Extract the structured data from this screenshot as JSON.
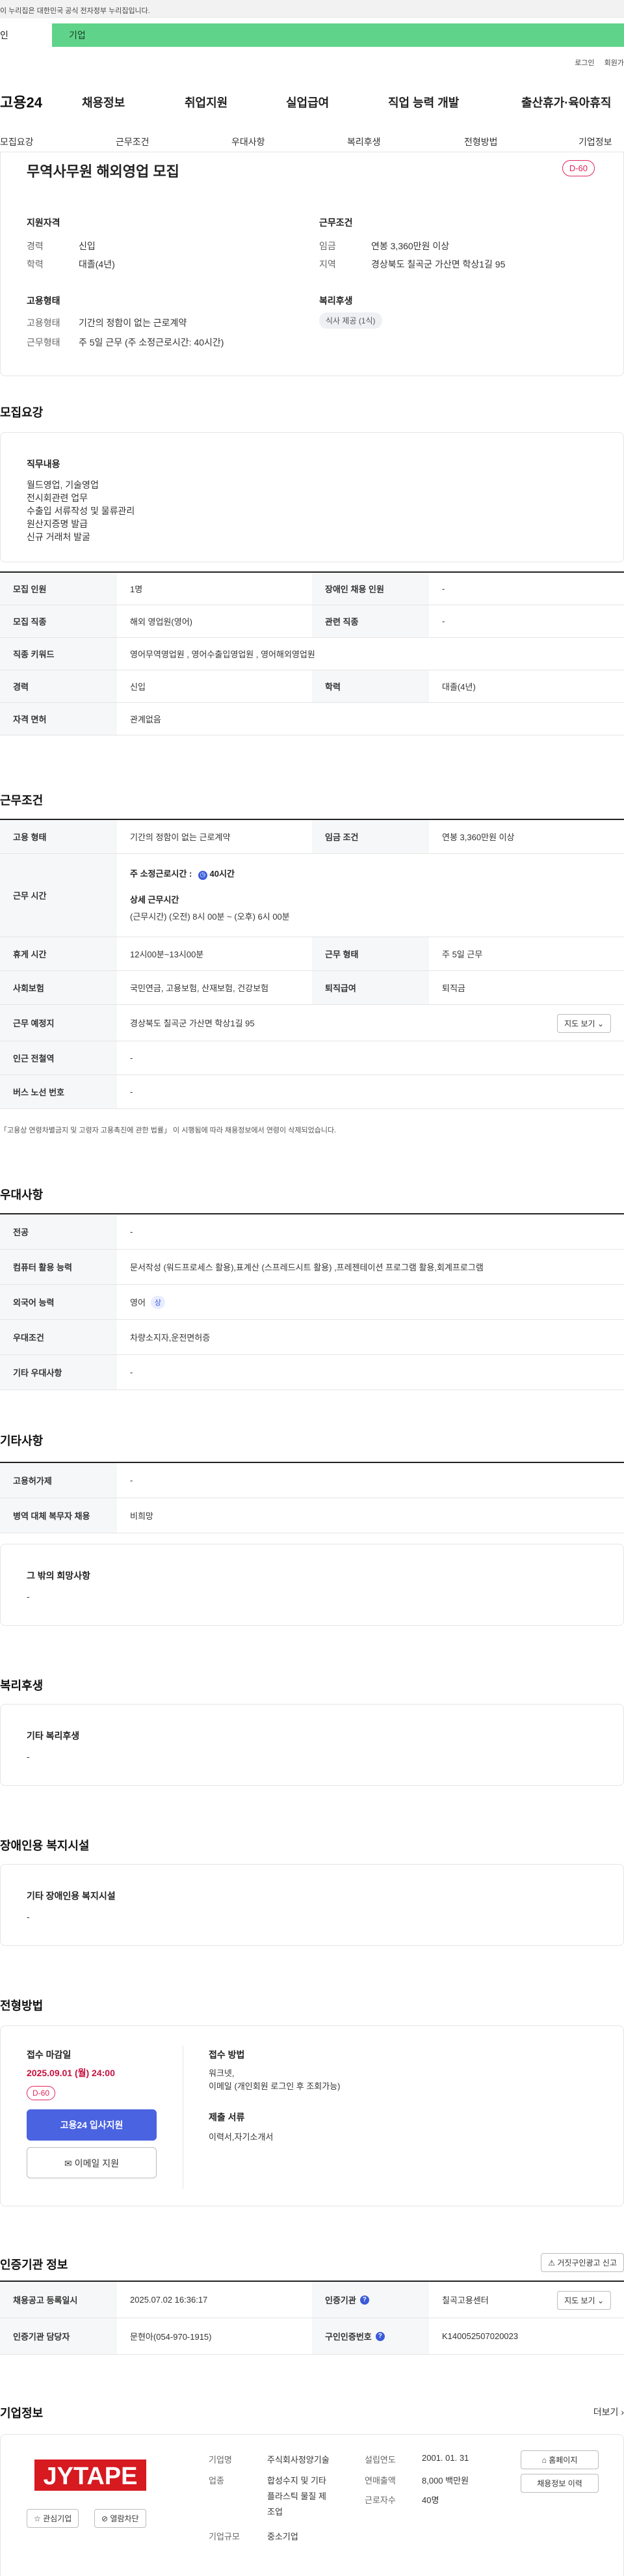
{
  "gov_notice": "이 누리집은 대한민국 공식 전자정부 누리집입니다.",
  "tabs": {
    "person": "인",
    "corp": "기업"
  },
  "util": {
    "login": "로그인",
    "join": "회원가"
  },
  "gnb": {
    "logo": "고용24",
    "menus": [
      "채용정보",
      "취업지원",
      "실업급여",
      "직업 능력 개발",
      "출산휴가·육아휴직"
    ]
  },
  "subnav": [
    "모집요강",
    "근무조건",
    "우대사항",
    "복리후생",
    "전형방법",
    "기업정보"
  ],
  "summary": {
    "title": "무역사무원 해외영업 모집",
    "dday": "D-60",
    "qual_label": "지원자격",
    "career_k": "경력",
    "career_v": "신입",
    "edu_k": "학력",
    "edu_v": "대졸(4년)",
    "cond_label": "근무조건",
    "wage_k": "임금",
    "wage_v": "연봉 3,360만원 이상",
    "region_k": "지역",
    "region_v": "경상북도 칠곡군 가산면 학상1길 95",
    "emp_label": "고용형태",
    "emp_k": "고용형태",
    "emp_v": "기간의 정함이 없는 근로계약",
    "work_k": "근무형태",
    "work_v": "주 5일 근무 (주 소정근로시간: 40시간)",
    "welfare_label": "복리후생",
    "welfare_chip": "식사 제공 (1식)"
  },
  "recruit": {
    "heading": "모집요강",
    "duty_title": "직무내용",
    "duty_lines": [
      "월드영업, 기술영업",
      "전시회관련 업무",
      "수출입 서류작성 및 물류관리",
      "원산지증명 발급",
      "신규 거래처 발굴"
    ],
    "rows": [
      {
        "k1": "모집 인원",
        "v1": "1명",
        "k2": "장애인 채용 인원",
        "v2": "-"
      },
      {
        "k1": "모집 직종",
        "v1": "해외 영업원(영어)",
        "k2": "관련 직종",
        "v2": "-"
      },
      {
        "k1": "직종 키워드",
        "v1": "영어무역영업원 , 영어수출입영업원 , 영어해외영업원"
      },
      {
        "k1": "경력",
        "v1": "신입",
        "k2": "학력",
        "v2": "대졸(4년)"
      },
      {
        "k1": "자격 면허",
        "v1": "관계없음"
      }
    ]
  },
  "workcond": {
    "heading": "근무조건",
    "r1": {
      "k1": "고용 형태",
      "v1": "기간의 정함이 없는 근로계약",
      "k2": "임금 조건",
      "v2": "연봉 3,360만원 이상"
    },
    "r2": {
      "k1": "근무 시간",
      "hours_prefix": "주 소정근로시간 :",
      "hours_val": "40시간",
      "detail_title": "상세 근무시간",
      "detail": "(근무시간) (오전) 8시 00분 ~ (오후) 6시 00분"
    },
    "r3": {
      "k1": "휴게 시간",
      "v1": "12시00분~13시00분",
      "k2": "근무 형태",
      "v2": "주 5일 근무"
    },
    "r4": {
      "k1": "사회보험",
      "v1": "국민연금, 고용보험, 산재보험, 건강보험",
      "k2": "퇴직급여",
      "v2": "퇴직금"
    },
    "r5": {
      "k1": "근무 예정지",
      "v1": "경상북도 칠곡군 가산면 학상1길 95",
      "btn": "지도 보기"
    },
    "r6": {
      "k1": "인근 전철역",
      "v1": "-"
    },
    "r7": {
      "k1": "버스 노선 번호",
      "v1": "-"
    },
    "note": "「고용상 연령차별금지 및 고령자 고용촉진에 관한 법률」 이 시행됨에 따라 채용정보에서 연령이 삭제되었습니다."
  },
  "pref": {
    "heading": "우대사항",
    "rows": [
      {
        "k": "전공",
        "v": "-"
      },
      {
        "k": "컴퓨터 활용 능력",
        "v": "문서작성 (워드프로세스 활용),표계산 (스프레드시트 활용) ,프레젠테이션 프로그램 활용,회계프로그램"
      },
      {
        "k": "외국어 능력",
        "v": "영어",
        "badge": "상"
      },
      {
        "k": "우대조건",
        "v": "차량소지자,운전면허증"
      },
      {
        "k": "기타 우대사항",
        "v": "-"
      }
    ]
  },
  "etc": {
    "heading": "기타사항",
    "rows": [
      {
        "k": "고용허가제",
        "v": "-"
      },
      {
        "k": "병역 대체 복무자 채용",
        "v": "비희망"
      }
    ],
    "box_title": "그 밖의 희망사항",
    "box_val": "-"
  },
  "welfare": {
    "heading": "복리후생",
    "box_title": "기타 복리후생",
    "box_val": "-"
  },
  "disabled": {
    "heading": "장애인용 복지시설",
    "box_title": "기타 장애인용 복지시설",
    "box_val": "-"
  },
  "process": {
    "heading": "전형방법",
    "deadline_label": "접수 마감일",
    "deadline": "2025.09.01 (월) 24:00",
    "dday": "D-60",
    "apply_btn": "고용24 입사지원",
    "email_btn": "이메일 지원",
    "method_label": "접수 방법",
    "method_lines": [
      "워크넷,",
      "이메일 (개인회원 로그인 후 조회가능)"
    ],
    "docs_label": "제출 서류",
    "docs_val": "이력서,자기소개서"
  },
  "cert": {
    "heading": "인증기관 정보",
    "report_btn": "거짓구인광고 신고",
    "r1": {
      "k1": "채용공고 등록일시",
      "v1": "2025.07.02 16:36:17",
      "k2": "인증기관",
      "v2": "칠곡고용센터",
      "btn": "지도 보기"
    },
    "r2": {
      "k1": "인증기관 담당자",
      "v1": "문현아(054-970-1915)",
      "k2": "구인인증번호",
      "v2": "K140052507020023"
    }
  },
  "company": {
    "heading": "기업정보",
    "more": "더보기",
    "logo_text": "JYTAPE",
    "interest_btn": "관심기업",
    "block_btn": "열람차단",
    "name_k": "기업명",
    "name_v": "주식회사정양기술",
    "industry_k": "업종",
    "industry_v": [
      "합성수지 및 기타",
      "플라스틱 물질 제",
      "조업"
    ],
    "size_k": "기업규모",
    "size_v": "중소기업",
    "est_k": "설립연도",
    "est_v": "2001. 01. 31",
    "sales_k": "연매출액",
    "sales_v": "8,000 백만원",
    "emp_k": "근로자수",
    "emp_v": "40명",
    "home_btn": "홈페이지",
    "jobs_btn": "채용정보 이력"
  },
  "colors": {
    "corp_tab": "#5fd389",
    "accent_red": "#e0245e",
    "apply_blue": "#4a63e0"
  }
}
